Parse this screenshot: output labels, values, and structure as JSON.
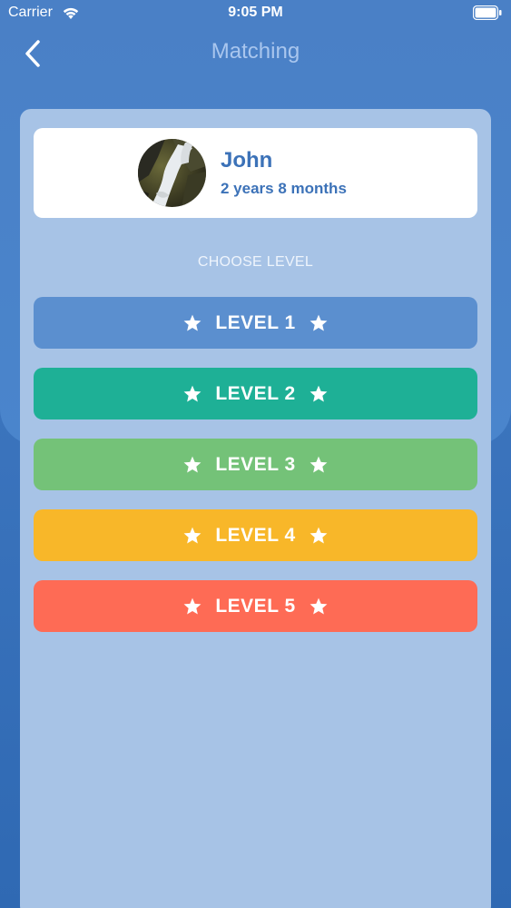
{
  "status_bar": {
    "carrier": "Carrier",
    "time": "9:05 PM"
  },
  "nav": {
    "title": "Matching",
    "back_icon": "chevron-left-icon"
  },
  "profile": {
    "name": "John",
    "age": "2 years 8 months"
  },
  "choose_label": "CHOOSE LEVEL",
  "levels": [
    {
      "label": "LEVEL 1",
      "color": "#5b8fcf"
    },
    {
      "label": "LEVEL 2",
      "color": "#1eb096"
    },
    {
      "label": "LEVEL 3",
      "color": "#74c278"
    },
    {
      "label": "LEVEL 4",
      "color": "#f8b729"
    },
    {
      "label": "LEVEL 5",
      "color": "#fe6b55"
    }
  ],
  "colors": {
    "background": "#3b74bd",
    "panel": "#a7c3e6",
    "accent_text": "#3c72b8",
    "title_text": "#a9c6ee"
  }
}
